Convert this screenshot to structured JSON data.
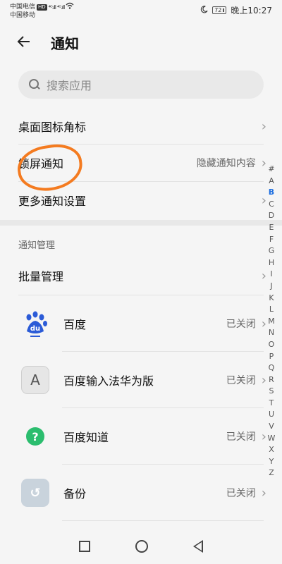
{
  "status_bar": {
    "carrier1": "中国电信",
    "carrier1_badge": "HD",
    "carrier2": "中国移动",
    "signal1": "⁴ᴳ.ıll",
    "signal2": "⁴ᴳ.ıll",
    "battery": "72",
    "time": "晚上10:27",
    "moon_icon": "moon-icon",
    "wifi_icon": "wifi-icon"
  },
  "header": {
    "back_icon": "back-arrow-icon",
    "title": "通知"
  },
  "search": {
    "placeholder": "搜索应用"
  },
  "settings": [
    {
      "label": "桌面图标角标",
      "value": ""
    },
    {
      "label": "锁屏通知",
      "value": "隐藏通知内容"
    },
    {
      "label": "更多通知设置",
      "value": ""
    }
  ],
  "management": {
    "section_title": "通知管理",
    "batch_label": "批量管理"
  },
  "apps": [
    {
      "name": "百度",
      "status": "已关闭",
      "icon": "baidu-icon",
      "glyph": "du"
    },
    {
      "name": "百度输入法华为版",
      "status": "已关闭",
      "icon": "baidu-ime-icon",
      "glyph": "A"
    },
    {
      "name": "百度知道",
      "status": "已关闭",
      "icon": "baidu-zhidao-icon",
      "glyph": "?"
    },
    {
      "name": "备份",
      "status": "已关闭",
      "icon": "backup-icon",
      "glyph": "↺"
    }
  ],
  "index_letters": [
    "#",
    "A",
    "B",
    "C",
    "D",
    "E",
    "F",
    "G",
    "H",
    "I",
    "J",
    "K",
    "L",
    "M",
    "N",
    "O",
    "P",
    "Q",
    "R",
    "S",
    "T",
    "U",
    "V",
    "W",
    "X",
    "Y",
    "Z"
  ],
  "index_active": "B",
  "chevron": "›",
  "colors": {
    "accent": "#1e6fe0",
    "annotation": "#f47b20",
    "zhidao_green": "#2bbd6e"
  }
}
